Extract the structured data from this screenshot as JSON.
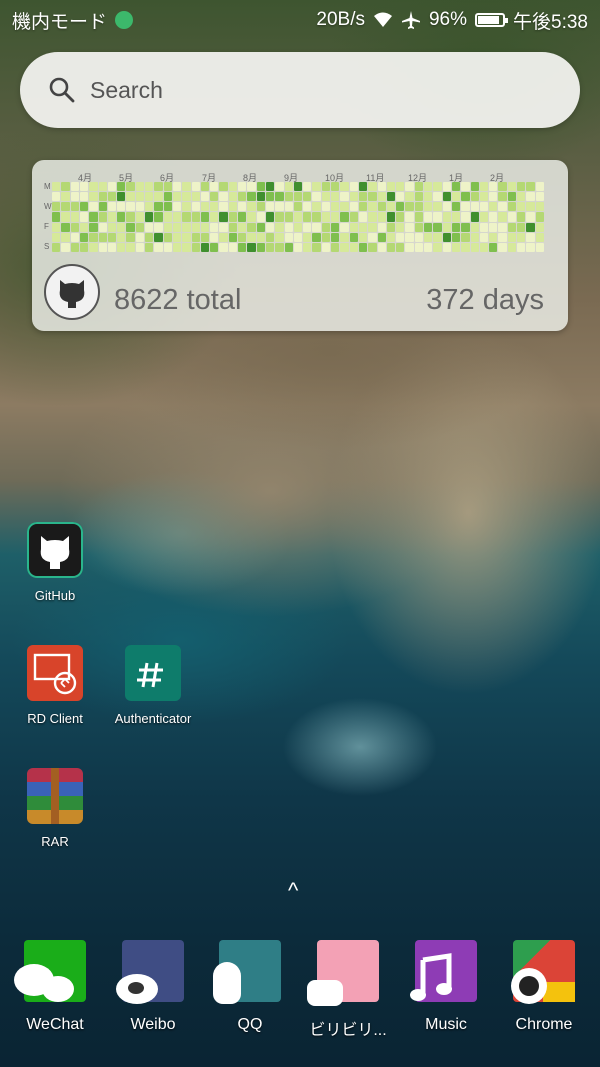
{
  "status_bar": {
    "mode": "機内モード",
    "speed": "20B/s",
    "battery": "96%",
    "battery_level": 0.96,
    "time": "午後5:38",
    "icons": [
      "wechat-notification-icon",
      "wifi-icon",
      "airplane-icon",
      "battery-icon"
    ]
  },
  "search": {
    "placeholder": "Search",
    "icon": "search-icon"
  },
  "github_widget": {
    "months": [
      "4月",
      "5月",
      "6月",
      "7月",
      "8月",
      "9月",
      "10月",
      "11月",
      "12月",
      "1月",
      "2月"
    ],
    "day_labels": [
      "M",
      "W",
      "F",
      "S"
    ],
    "total": "8622 total",
    "days": "372 days",
    "colors": [
      "#eef3c8",
      "#d6e99a",
      "#b4d873",
      "#7fbf4e",
      "#3f8f2e"
    ]
  },
  "home_apps": [
    {
      "label": "GitHub",
      "icon": "github-icon"
    },
    {
      "label": "RD Client",
      "icon": "remote-desktop-icon"
    },
    {
      "label": "Authenticator",
      "icon": "authenticator-icon"
    },
    {
      "label": "RAR",
      "icon": "rar-icon"
    }
  ],
  "drawer": {
    "icon": "chevron-up-icon",
    "glyph": "^"
  },
  "dock": [
    {
      "label": "WeChat",
      "icon": "wechat-icon",
      "color": "#1aad19"
    },
    {
      "label": "Weibo",
      "icon": "weibo-icon",
      "color": "#3f4d84"
    },
    {
      "label": "QQ",
      "icon": "qq-icon",
      "color": "#2f7e86"
    },
    {
      "label": "ビリビリ...",
      "icon": "bilibili-icon",
      "color": "#f3a1b5"
    },
    {
      "label": "Music",
      "icon": "music-icon",
      "color": "#8e3cb5"
    },
    {
      "label": "Chrome",
      "icon": "chrome-icon",
      "color": "#db4437"
    }
  ]
}
